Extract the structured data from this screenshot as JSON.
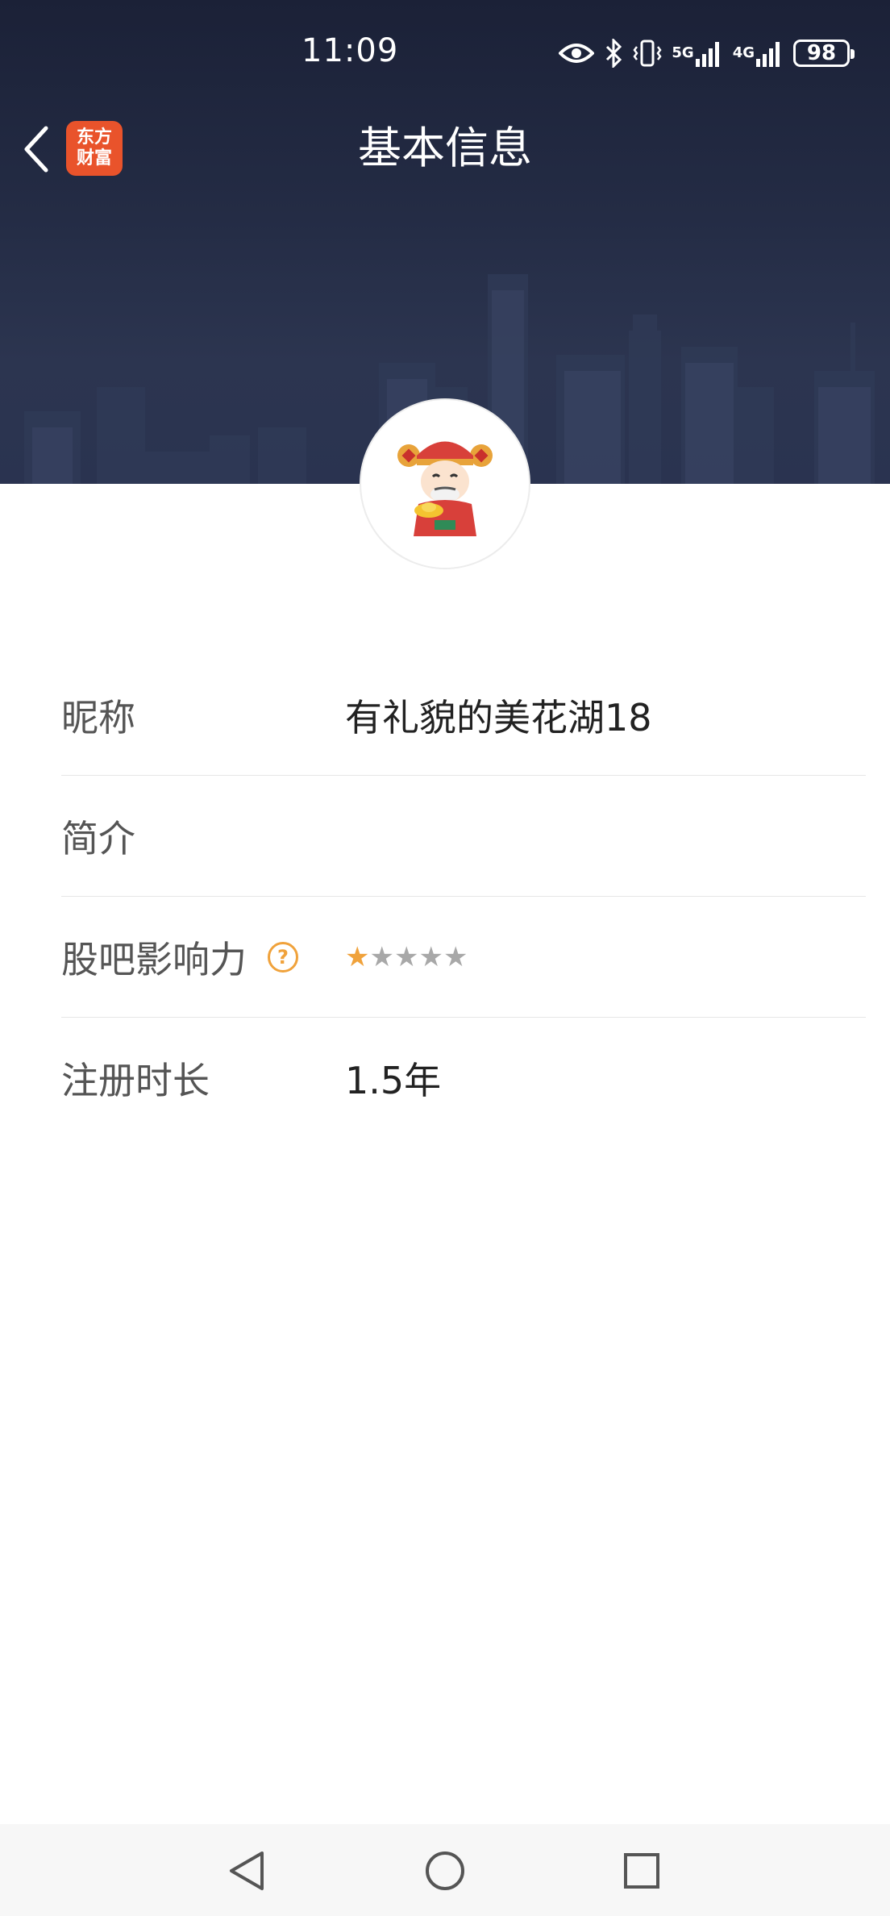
{
  "status_bar": {
    "time": "11:09",
    "network_5g": "5G",
    "network_4g": "4G",
    "battery": "98",
    "icons": [
      "eye-icon",
      "bluetooth-icon",
      "vibrate-icon",
      "signal-5g-icon",
      "signal-4g-icon",
      "battery-icon"
    ]
  },
  "header": {
    "title": "基本信息",
    "back_icon": "chevron-left-icon",
    "logo_line1": "东方",
    "logo_line2": "财富"
  },
  "profile": {
    "avatar_icon": "fortune-god-avatar"
  },
  "info_rows": {
    "nickname": {
      "label": "昵称",
      "value": "有礼貌的美花湖18"
    },
    "intro": {
      "label": "简介",
      "value": ""
    },
    "influence": {
      "label": "股吧影响力",
      "help": "?",
      "stars_filled": 1,
      "stars_total": 5
    },
    "register": {
      "label": "注册时长",
      "value": "1.5年"
    }
  },
  "colors": {
    "header_bg": "#242c45",
    "accent_orange": "#f0a23b",
    "logo_red": "#e9532b"
  },
  "system_nav": {
    "icons": [
      "back-triangle-icon",
      "home-circle-icon",
      "recents-square-icon"
    ]
  }
}
